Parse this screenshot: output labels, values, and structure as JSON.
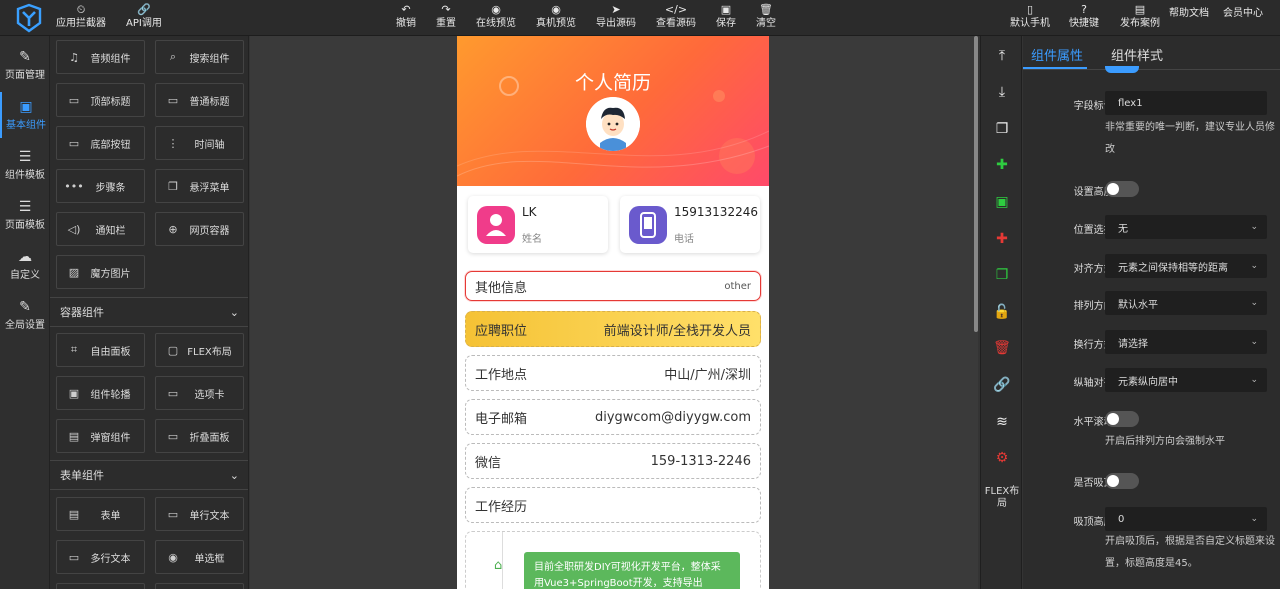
{
  "topbar": {
    "left": [
      {
        "label": "应用拦截器",
        "icon": "clock-icon"
      },
      {
        "label": "API调用",
        "icon": "link-icon"
      }
    ],
    "center": [
      {
        "label": "撤销",
        "icon": "undo-icon"
      },
      {
        "label": "重置",
        "icon": "redo-icon"
      },
      {
        "label": "在线预览",
        "icon": "eye-icon"
      },
      {
        "label": "真机预览",
        "icon": "eye-icon"
      },
      {
        "label": "导出源码",
        "icon": "send-icon"
      },
      {
        "label": "查看源码",
        "icon": "code-icon"
      },
      {
        "label": "保存",
        "icon": "save-icon"
      },
      {
        "label": "清空",
        "icon": "trash-icon"
      }
    ],
    "right": [
      {
        "label": "默认手机",
        "icon": "phone-icon"
      },
      {
        "label": "快捷键",
        "icon": "question-icon"
      },
      {
        "label": "发布案例",
        "icon": "image-icon"
      },
      {
        "label": "帮助文档",
        "icon": ""
      },
      {
        "label": "会员中心",
        "icon": ""
      }
    ]
  },
  "rail": [
    {
      "label": "页面管理",
      "icon": "pencil-icon"
    },
    {
      "label": "基本组件",
      "icon": "component-icon",
      "active": true
    },
    {
      "label": "组件模板",
      "icon": "database-icon"
    },
    {
      "label": "页面模板",
      "icon": "database-icon"
    },
    {
      "label": "自定义",
      "icon": "cloud-icon"
    },
    {
      "label": "全局设置",
      "icon": "pencil-icon"
    }
  ],
  "components": {
    "basic": [
      {
        "label": "音频组件",
        "icon": "music-icon"
      },
      {
        "label": "搜索组件",
        "icon": "search-icon"
      },
      {
        "label": "顶部标题",
        "icon": "header-icon"
      },
      {
        "label": "普通标题",
        "icon": "title-icon"
      },
      {
        "label": "底部按钮",
        "icon": "footer-icon"
      },
      {
        "label": "时间轴",
        "icon": "timeline-icon"
      },
      {
        "label": "步骤条",
        "icon": "steps-icon"
      },
      {
        "label": "悬浮菜单",
        "icon": "float-icon"
      },
      {
        "label": "通知栏",
        "icon": "speaker-icon"
      },
      {
        "label": "网页容器",
        "icon": "globe-icon"
      },
      {
        "label": "魔方图片",
        "icon": "picture-icon"
      }
    ],
    "container_title": "容器组件",
    "container": [
      {
        "label": "自由面板",
        "icon": "frame-icon"
      },
      {
        "label": "FLEX布局",
        "icon": "flex-icon"
      },
      {
        "label": "组件轮播",
        "icon": "carousel-icon"
      },
      {
        "label": "选项卡",
        "icon": "folder-icon"
      },
      {
        "label": "弹窗组件",
        "icon": "dialog-icon"
      },
      {
        "label": "折叠面板",
        "icon": "collapse-icon"
      }
    ],
    "form_title": "表单组件",
    "form": [
      {
        "label": "表单",
        "icon": "form-icon"
      },
      {
        "label": "单行文本",
        "icon": "input-icon"
      },
      {
        "label": "多行文本",
        "icon": "textarea-icon"
      },
      {
        "label": "单选框",
        "icon": "radio-icon"
      }
    ]
  },
  "phone": {
    "title": "个人简历",
    "name_value": "LK",
    "name_label": "姓名",
    "phone_value": "15913132246",
    "phone_label": "电话",
    "rows": [
      {
        "label": "其他信息",
        "value": "other",
        "style": "sel"
      },
      {
        "label": "应聘职位",
        "value": "前端设计师/全栈开发人员",
        "style": "gold"
      },
      {
        "label": "工作地点",
        "value": "中山/广州/深圳",
        "style": "dash"
      },
      {
        "label": "电子邮箱",
        "value": "diygwcom@diyygw.com",
        "style": "dash"
      },
      {
        "label": "微信",
        "value": "159-1313-2246",
        "style": "dash"
      },
      {
        "label": "工作经历",
        "value": "",
        "style": "dash"
      }
    ],
    "timeline_text": "目前全职研发DIY可视化开发平台，整体采用Vue3+SpringBoot开发，支持导出"
  },
  "tools": {
    "flex_label": "FLEX布局"
  },
  "props": {
    "tab_attr": "组件属性",
    "tab_style": "组件样式",
    "field_id_label": "字段标识:",
    "field_id_value": "flex1",
    "field_id_hint": "非常重要的唯一判断，建议专业人员修改",
    "height_label": "设置高度:",
    "position_label": "位置选择:",
    "position_value": "无",
    "align_label": "对齐方式:",
    "align_value": "元素之间保持相等的距离",
    "direction_label": "排列方向:",
    "direction_value": "默认水平",
    "wrap_label": "换行方式:",
    "wrap_value": "请选择",
    "cross_label": "纵轴对齐:",
    "cross_value": "元素纵向居中",
    "hscroll_label": "水平滚动:",
    "hscroll_hint": "开启后排列方向会强制水平",
    "sticky_label": "是否吸顶:",
    "sticky_height_label": "吸顶高度:",
    "sticky_height_value": "0",
    "sticky_hint": "开启吸顶后，根据是否自定义标题来设置，标题高度是45。"
  },
  "colors": {
    "accent": "#3b9cff",
    "selected_border": "#e53935",
    "green_tool": "#2ecc40",
    "red_tool": "#e53935"
  }
}
